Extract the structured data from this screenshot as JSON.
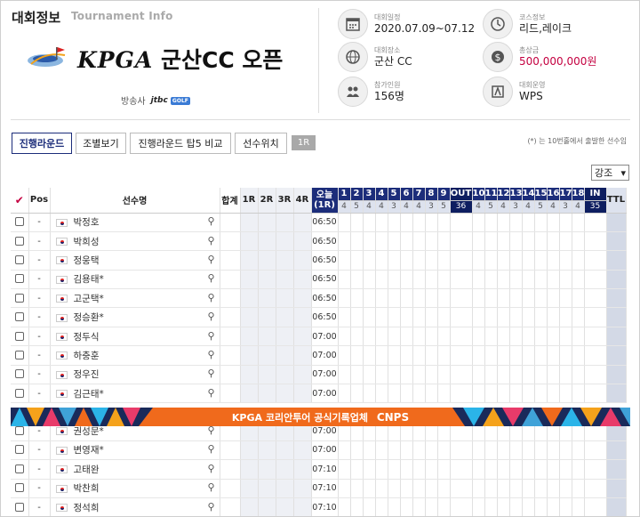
{
  "header": {
    "title": "대회정보",
    "subtitle": "Tournament Info",
    "tournament_kpga": "KPGA",
    "tournament_name": "군산CC 오픈",
    "broadcaster_label": "방송사",
    "broadcaster_name": "jtbc",
    "broadcaster_badge": "GOLF"
  },
  "meta": [
    {
      "label": "대회일정",
      "value": "2020.07.09~07.12",
      "icon": "calendar-icon"
    },
    {
      "label": "코스정보",
      "value": "리드,레이크",
      "icon": "clock-icon"
    },
    {
      "label": "대회장소",
      "value": "군산 CC",
      "icon": "globe-icon"
    },
    {
      "label": "총상금",
      "value": "500,000,000원",
      "icon": "dollar-icon"
    },
    {
      "label": "참가인원",
      "value": "156명",
      "icon": "people-icon"
    },
    {
      "label": "대회운영",
      "value": "WPS",
      "icon": "flag-icon"
    }
  ],
  "tabs": [
    "진행라운드",
    "조별보기",
    "진행라운드 탑5 비교",
    "선수위치",
    "1R"
  ],
  "note": "(*) 는 10번홀에서 출발한 선수임",
  "sort": {
    "selected": "강조"
  },
  "table": {
    "headers": {
      "pos": "Pos",
      "name": "선수명",
      "total": "합계",
      "r1": "1R",
      "r2": "2R",
      "r3": "3R",
      "r4": "4R",
      "today_line1": "오늘",
      "today_line2": "(1R)",
      "out": "OUT",
      "in": "IN",
      "ttl": "TTL"
    },
    "holes_front": [
      "1",
      "2",
      "3",
      "4",
      "5",
      "6",
      "7",
      "8",
      "9"
    ],
    "par_front": [
      "4",
      "5",
      "4",
      "4",
      "3",
      "4",
      "4",
      "3",
      "5"
    ],
    "par_out": "36",
    "holes_back": [
      "10",
      "11",
      "12",
      "13",
      "14",
      "15",
      "16",
      "17",
      "18"
    ],
    "par_back": [
      "4",
      "5",
      "4",
      "3",
      "4",
      "5",
      "4",
      "3",
      "4"
    ],
    "par_in": "35",
    "rows_top": [
      {
        "pos": "-",
        "name": "박정호",
        "time": "06:50"
      },
      {
        "pos": "-",
        "name": "박희성",
        "time": "06:50"
      },
      {
        "pos": "-",
        "name": "정웅택",
        "time": "06:50"
      },
      {
        "pos": "-",
        "name": "김용태*",
        "time": "06:50"
      },
      {
        "pos": "-",
        "name": "고군택*",
        "time": "06:50"
      },
      {
        "pos": "-",
        "name": "정승환*",
        "time": "06:50"
      },
      {
        "pos": "-",
        "name": "정두식",
        "time": "07:00"
      },
      {
        "pos": "-",
        "name": "하충훈",
        "time": "07:00"
      },
      {
        "pos": "-",
        "name": "정우진",
        "time": "07:00"
      },
      {
        "pos": "-",
        "name": "김근태*",
        "time": "07:00"
      }
    ],
    "rows_bottom": [
      {
        "pos": "-",
        "name": "권성문*",
        "time": "07:00"
      },
      {
        "pos": "-",
        "name": "변영재*",
        "time": "07:00"
      },
      {
        "pos": "-",
        "name": "고태완",
        "time": "07:10"
      },
      {
        "pos": "-",
        "name": "박찬희",
        "time": "07:10"
      },
      {
        "pos": "-",
        "name": "정석희",
        "time": "07:10"
      }
    ]
  },
  "banner": {
    "text": "KPGA 코리안투어 공식기록업체",
    "brand": "CNPS"
  }
}
